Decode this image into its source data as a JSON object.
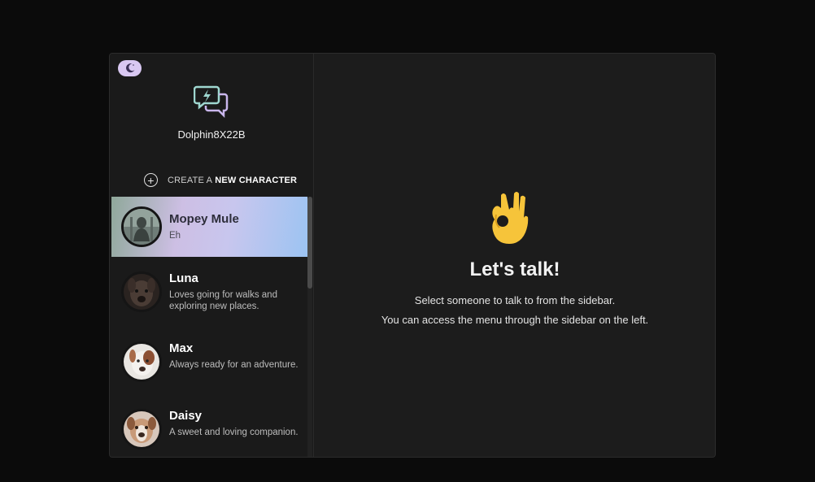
{
  "sidebar": {
    "username": "Dolphin8X22B",
    "create": {
      "prefix": "CREATE A",
      "strong": "NEW CHARACTER"
    },
    "characters": [
      {
        "name": "Mopey Mule",
        "desc": "Eh",
        "active": true
      },
      {
        "name": "Luna",
        "desc": "Loves going for walks and exploring new places."
      },
      {
        "name": "Max",
        "desc": "Always ready for an adventure."
      },
      {
        "name": "Daisy",
        "desc": "A sweet and loving companion."
      }
    ]
  },
  "main": {
    "title": "Let's talk!",
    "line1": "Select someone to talk to from the sidebar.",
    "line2": "You can access the menu through the sidebar on the left."
  },
  "colors": {
    "accent_lavender": "#d9c8f2",
    "emoji_yellow": "#f6c43a",
    "logo_teal": "#9fd7d0"
  },
  "icons": {
    "theme_toggle": "moon-icon",
    "logo": "chat-bubbles-lightning-icon",
    "create": "plus-circle-icon",
    "hero": "ok-hand-emoji"
  }
}
